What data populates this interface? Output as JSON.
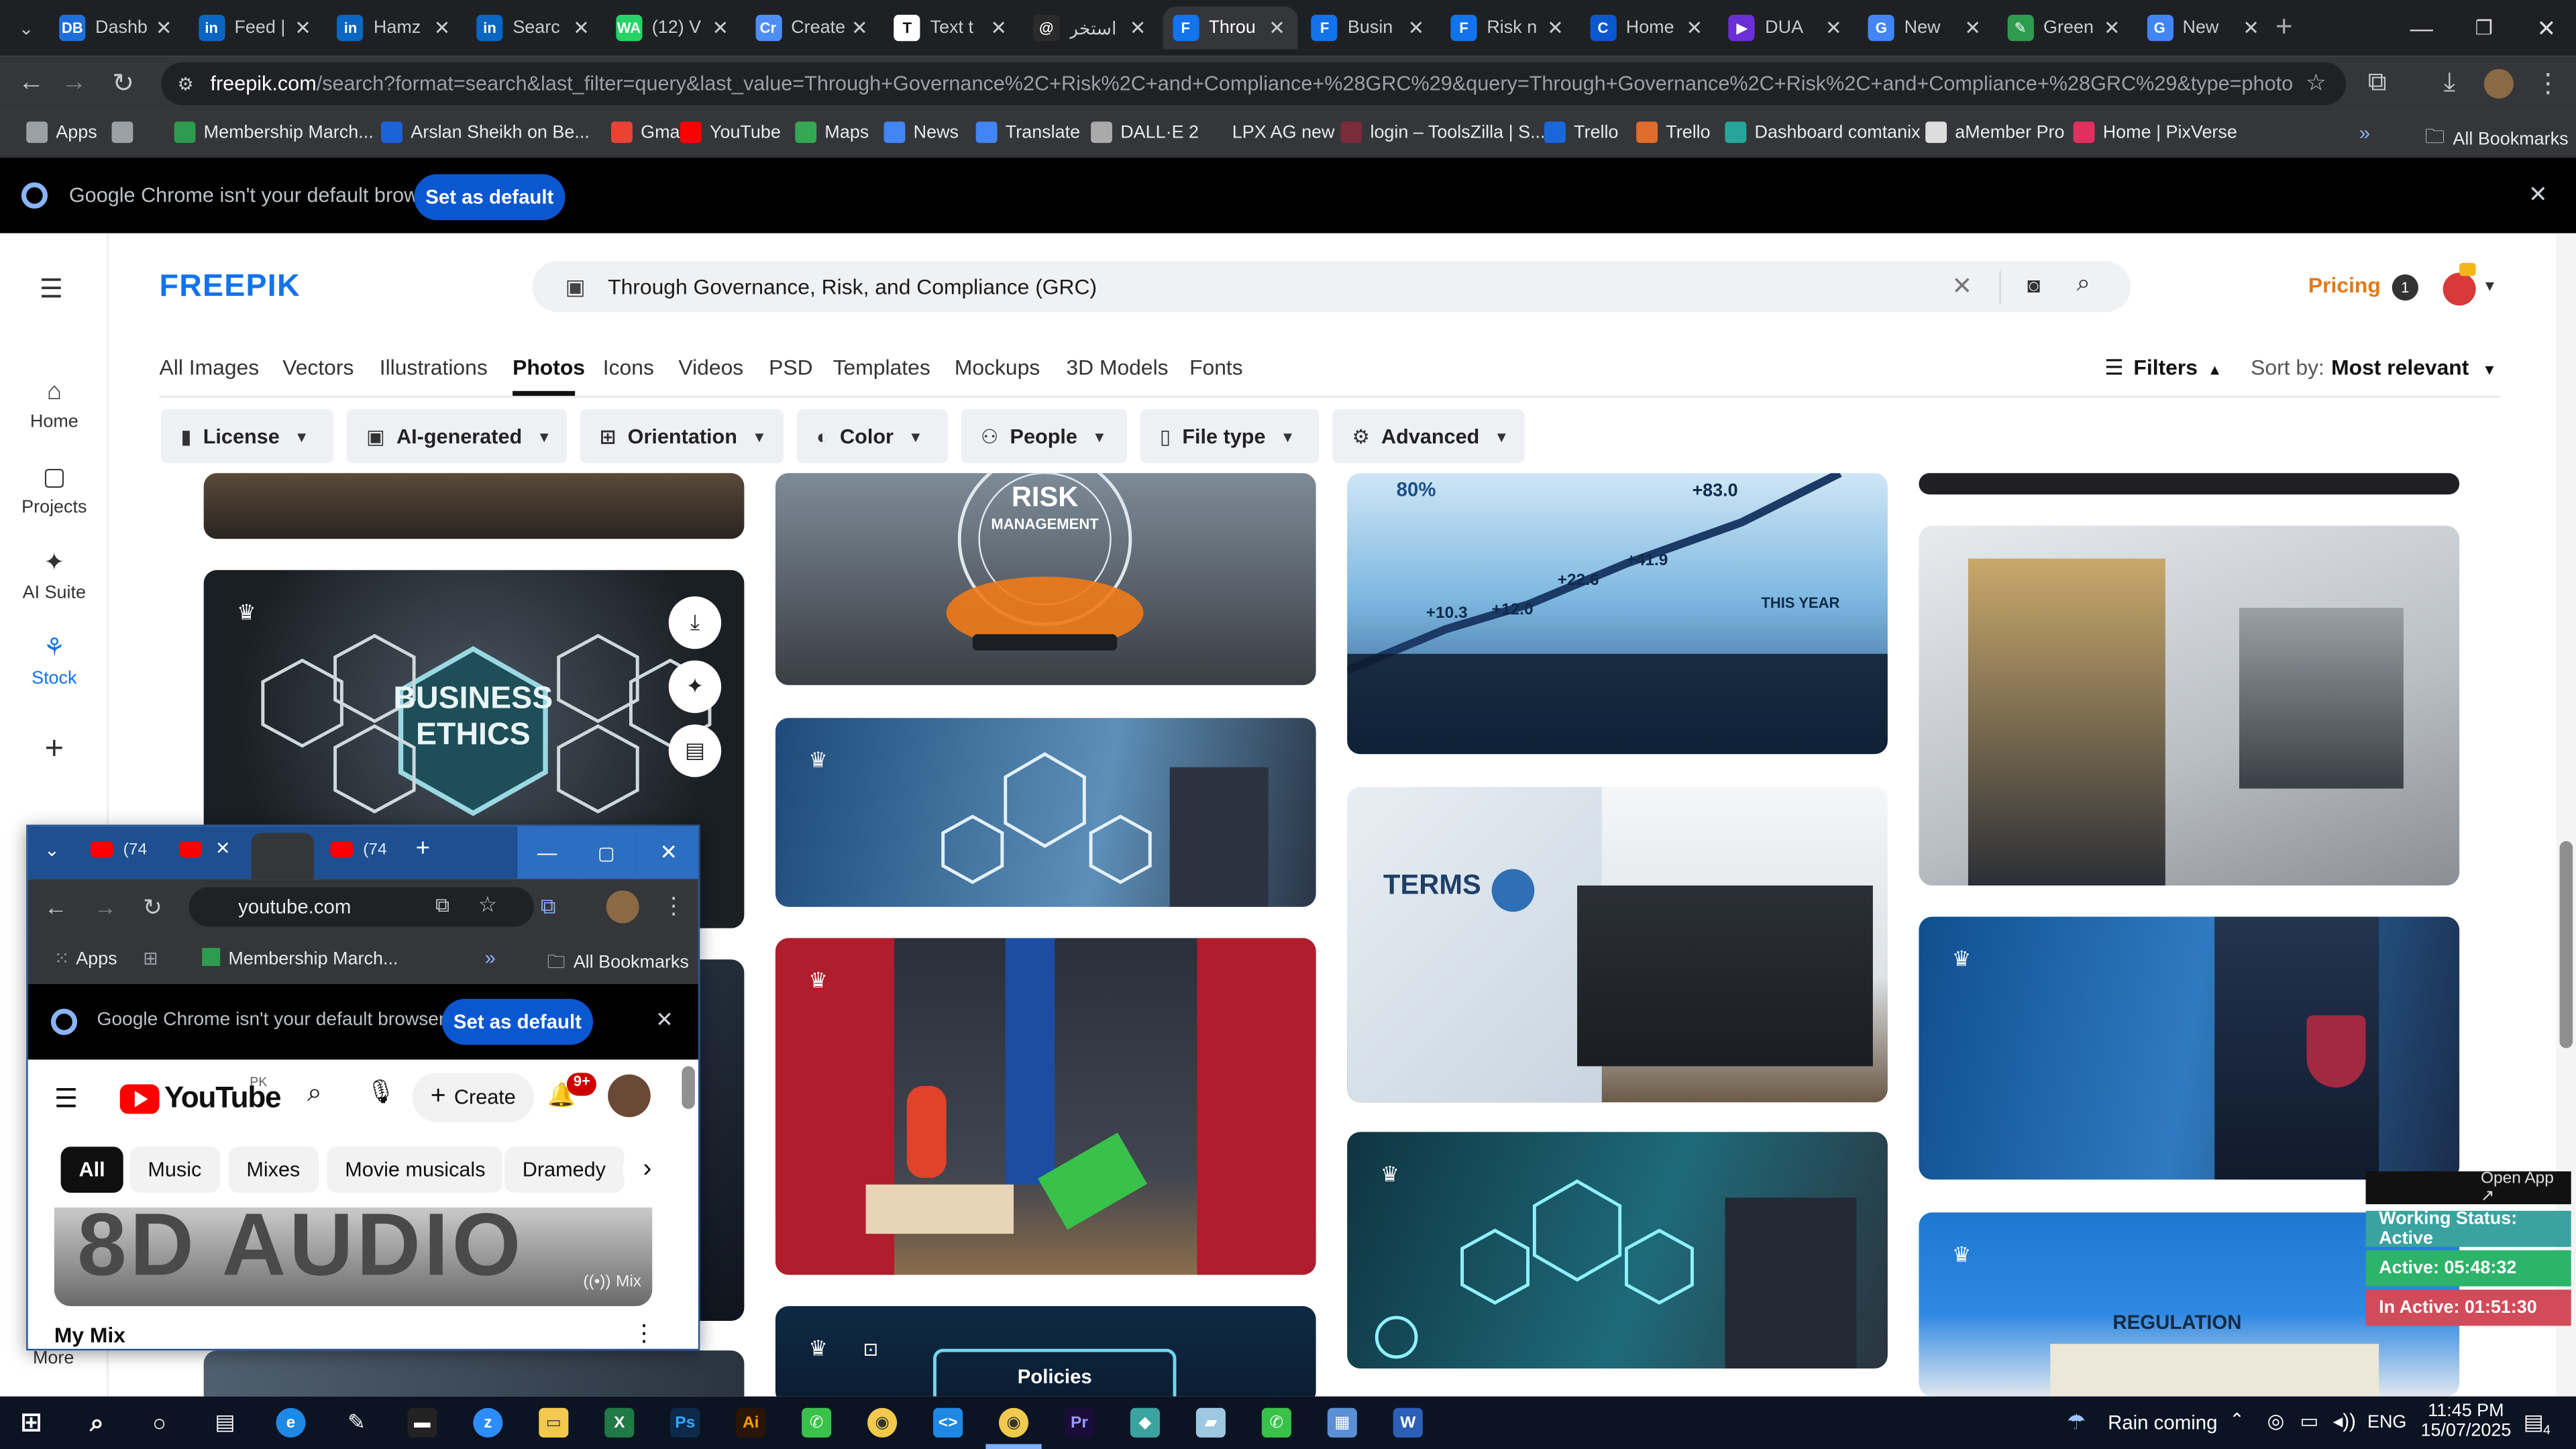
{
  "browser": {
    "tabs": [
      {
        "label": "Dashb",
        "fav": "DB",
        "color": "#1e6fd9"
      },
      {
        "label": "Feed |",
        "fav": "in",
        "color": "#0a66c2"
      },
      {
        "label": "Hamz",
        "fav": "in",
        "color": "#0a66c2"
      },
      {
        "label": "Searc",
        "fav": "in",
        "color": "#0a66c2"
      },
      {
        "label": "(12) V",
        "fav": "WA",
        "color": "#25d366"
      },
      {
        "label": "Create",
        "fav": "Cr",
        "color": "#4f8ef7"
      },
      {
        "label": "Text t",
        "fav": "T",
        "color": "#ffffff"
      },
      {
        "label": "استخر",
        "fav": "@",
        "color": "#2b2b2b"
      },
      {
        "label": "Throu",
        "fav": "F",
        "color": "#1273eb"
      },
      {
        "label": "Busin",
        "fav": "F",
        "color": "#1273eb"
      },
      {
        "label": "Risk n",
        "fav": "F",
        "color": "#1273eb"
      },
      {
        "label": "Home",
        "fav": "C",
        "color": "#0b57d0"
      },
      {
        "label": "DUA",
        "fav": "▶",
        "color": "#6b2fd6"
      },
      {
        "label": "New",
        "fav": "G",
        "color": "#4285f4"
      },
      {
        "label": "Green",
        "fav": "✎",
        "color": "#2e9b4f"
      },
      {
        "label": "New",
        "fav": "G",
        "color": "#4285f4"
      }
    ],
    "active_tab_index": 8,
    "url_host": "freepik.com",
    "url_path": "/search?format=search&last_filter=query&last_value=Through+Governance%2C+Risk%2C+and+Compliance+%28GRC%29&query=Through+Governance%2C+Risk%2C+and+Compliance+%28GRC%29&type=photo",
    "bookmarks": [
      {
        "label": "Apps",
        "color": "#9aa0a6"
      },
      {
        "label": "",
        "color": "#9aa0a6"
      },
      {
        "label": "Membership March...",
        "color": "#2e9b4f"
      },
      {
        "label": "Arslan Sheikh on Be...",
        "color": "#1d63d8"
      },
      {
        "label": "Gmail",
        "color": "#ea4335"
      },
      {
        "label": "YouTube",
        "color": "#ff0000"
      },
      {
        "label": "Maps",
        "color": "#34a853"
      },
      {
        "label": "News",
        "color": "#4285f4"
      },
      {
        "label": "Translate",
        "color": "#4285f4"
      },
      {
        "label": "DALL·E 2",
        "color": "#aaaaaa"
      },
      {
        "label": "LPX AG new",
        "color": "#35363a"
      },
      {
        "label": "login – ToolsZilla | S...",
        "color": "#7a2c3a"
      },
      {
        "label": "Trello",
        "color": "#1868db"
      },
      {
        "label": "Trello",
        "color": "#e06c2b"
      },
      {
        "label": "Dashboard comtanix",
        "color": "#26a69a"
      },
      {
        "label": "aMember Pro",
        "color": "#dddddd"
      },
      {
        "label": "Home | PixVerse",
        "color": "#e03060"
      }
    ],
    "all_bookmarks": "All Bookmarks",
    "default_browser_msg": "Google Chrome isn't your default browser",
    "set_default": "Set as default"
  },
  "freepik": {
    "logo": "FREEPIK",
    "search_query": "Through Governance, Risk, and Compliance (GRC)",
    "pricing": "Pricing",
    "notif_count": "1",
    "side_nav": [
      {
        "label": "Home",
        "icon": "home-icon"
      },
      {
        "label": "Projects",
        "icon": "projects-icon"
      },
      {
        "label": "AI Suite",
        "icon": "sparkle-icon"
      },
      {
        "label": "Stock",
        "icon": "stock-icon"
      },
      {
        "label": "",
        "icon": "plus-icon"
      },
      {
        "label": "More",
        "icon": "more-icon"
      }
    ],
    "tabs": [
      "All Images",
      "Vectors",
      "Illustrations",
      "Photos",
      "Icons",
      "Videos",
      "PSD",
      "Templates",
      "Mockups",
      "3D Models",
      "Fonts"
    ],
    "active_tab": "Photos",
    "filters_label": "Filters",
    "sort_label": "Sort by:",
    "sort_value": "Most relevant",
    "chips": [
      "License",
      "AI-generated",
      "Orientation",
      "Color",
      "People",
      "File type",
      "Advanced"
    ],
    "image_texts": {
      "ethics": [
        "BUSINESS",
        "ETHICS"
      ],
      "risk": [
        "RISK",
        "MANAGEMENT"
      ],
      "chart_numbers": [
        "80%",
        "+83.0",
        "+41.9",
        "+22.6",
        "+10.3",
        "+12.0",
        "THIS YEAR"
      ],
      "terms": "TERMS",
      "regulation": "REGULATION",
      "policies": "Policies"
    }
  },
  "widget": {
    "open_app": "Open App ↗",
    "working": "Working Status: Active",
    "active": "Active: 05:48:32",
    "inactive": "In Active: 01:51:30",
    "colors": {
      "working": "#3aa3a0",
      "active": "#2db36a",
      "inactive": "#d24b5a"
    }
  },
  "youtube_window": {
    "tabs": [
      "(74",
      "",
      "",
      "(74"
    ],
    "url": "youtube.com",
    "bookmarks": [
      "Apps",
      "Membership March...",
      "All Bookmarks"
    ],
    "default_msg": "Google Chrome isn't your default browser",
    "set_default": "Set as default",
    "logo": "YouTube",
    "region": "PK",
    "create": "Create",
    "notif": "9+",
    "chips": [
      "All",
      "Music",
      "Mixes",
      "Movie musicals",
      "Dramedy"
    ],
    "video_title_overlay": "8D AUDIO",
    "mix_badge": "Mix",
    "section_title": "My Mix",
    "more_label": "More"
  },
  "taskbar": {
    "weather": "Rain coming",
    "lang": "ENG",
    "time": "11:45 PM",
    "date": "15/07/2025",
    "notif_count": "4"
  }
}
